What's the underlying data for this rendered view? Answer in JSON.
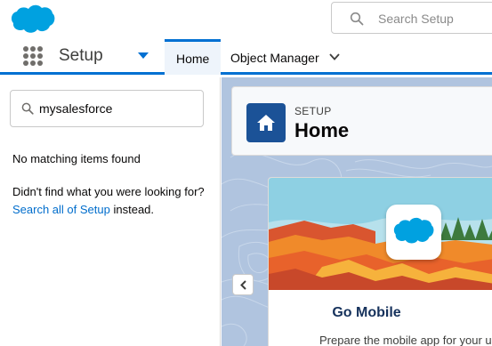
{
  "global_header": {
    "logo_icon": "salesforce-cloud-icon",
    "search": {
      "placeholder": "Search Setup",
      "icon": "search-icon"
    }
  },
  "context_bar": {
    "app_launcher_icon": "app-launcher-icon",
    "app_name": "Setup",
    "tabs": [
      {
        "label": "Home",
        "active": true
      },
      {
        "label": "Object Manager",
        "has_menu": true
      }
    ]
  },
  "left_panel": {
    "quick_find": {
      "value": "mysalesforce",
      "icon": "search-icon"
    },
    "no_match_text": "No matching items found",
    "didnt_find_prefix": "Didn't find what you were looking for?",
    "search_all_link": "Search all of Setup",
    "didnt_find_suffix": "instead."
  },
  "main": {
    "header": {
      "eyebrow": "SETUP",
      "title": "Home",
      "icon": "home-icon"
    },
    "collapse_icon": "chevron-left-icon",
    "mobile_card": {
      "title": "Go Mobile",
      "description": "Prepare the mobile app for your us"
    }
  },
  "colors": {
    "brand_blue": "#0070d2",
    "home_icon_bg": "#1b5297",
    "link": "#006dcc",
    "main_bg": "#b0c4df"
  }
}
